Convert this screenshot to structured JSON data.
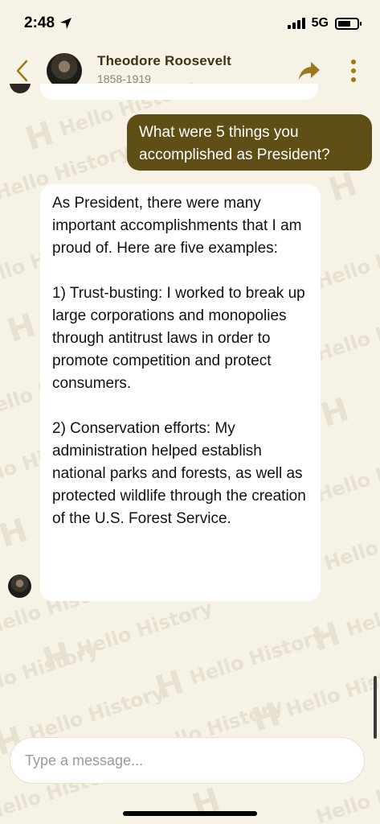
{
  "status_bar": {
    "time": "2:48",
    "network": "5G"
  },
  "header": {
    "name": "Theodore Roosevelt",
    "years": "1858-1919"
  },
  "watermark": {
    "letter": "H",
    "text": "Hello History"
  },
  "messages": {
    "user": "What were 5 things you accomplished as President?",
    "bot": {
      "intro": "As President, there were many important accomplishments that I am proud of. Here are five examples:",
      "item1": "1) Trust-busting: I worked to break up large corporations and monopolies through antitrust laws in order to promote competition and protect consumers.",
      "item2": "2) Conservation efforts: My administration helped establish national parks and forests, as well as protected wildlife through the creation of the U.S. Forest Service."
    }
  },
  "composer": {
    "placeholder": "Type a message..."
  },
  "colors": {
    "accent": "#9b7a1e",
    "user_bubble": "#5f4e15",
    "background": "#f6f2e6"
  }
}
